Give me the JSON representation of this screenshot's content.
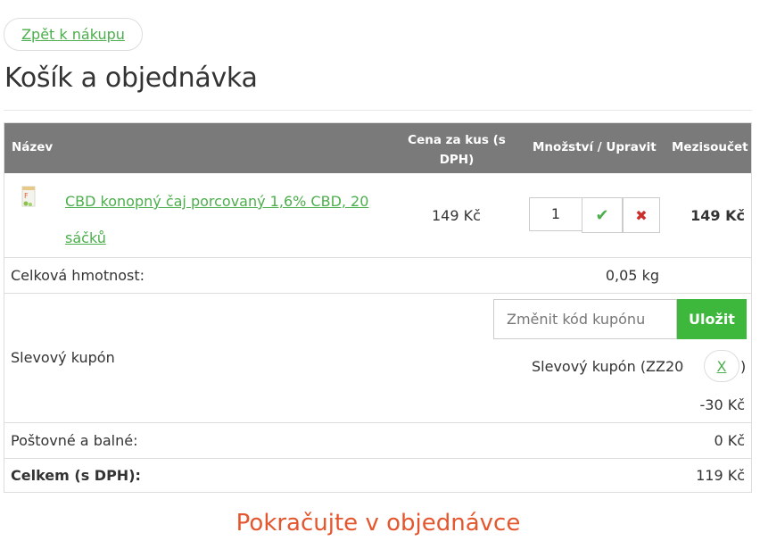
{
  "nav": {
    "back_label": "Zpět k nákupu"
  },
  "page": {
    "title": "Košík a objednávka"
  },
  "table": {
    "headers": {
      "name": "Název",
      "unit_price": "Cena za kus (s DPH)",
      "quantity": "Množství / Upravit",
      "subtotal": "Mezisoučet"
    },
    "items": [
      {
        "name": "CBD konopný čaj porcovaný 1,6% CBD, 20 sáčků",
        "unit_price": "149 Kč",
        "quantity": "1",
        "subtotal": "149 Kč"
      }
    ],
    "weight": {
      "label": "Celková hmotnost:",
      "value": "0,05 kg"
    },
    "coupon": {
      "label": "Slevový kupón",
      "placeholder": "Změnit kód kupónu",
      "save_label": "Uložit",
      "applied_text": "Slevový kupón (ZZ20",
      "remove_label": "X",
      "close_paren": ")",
      "discount": "-30 Kč"
    },
    "shipping": {
      "label": "Poštovné a balné:",
      "value": "0 Kč"
    },
    "total": {
      "label": "Celkem (s DPH):",
      "value": "119 Kč"
    }
  },
  "footer": {
    "continue_label": "Pokračujte v objednávce"
  },
  "colors": {
    "accent_green": "#4cae4c",
    "button_green": "#3db83d",
    "header_gray": "#7a7a7a",
    "continue_orange": "#e4572e",
    "delete_red": "#c9302c"
  },
  "icons": {
    "confirm": "check-icon",
    "delete": "close-icon"
  }
}
